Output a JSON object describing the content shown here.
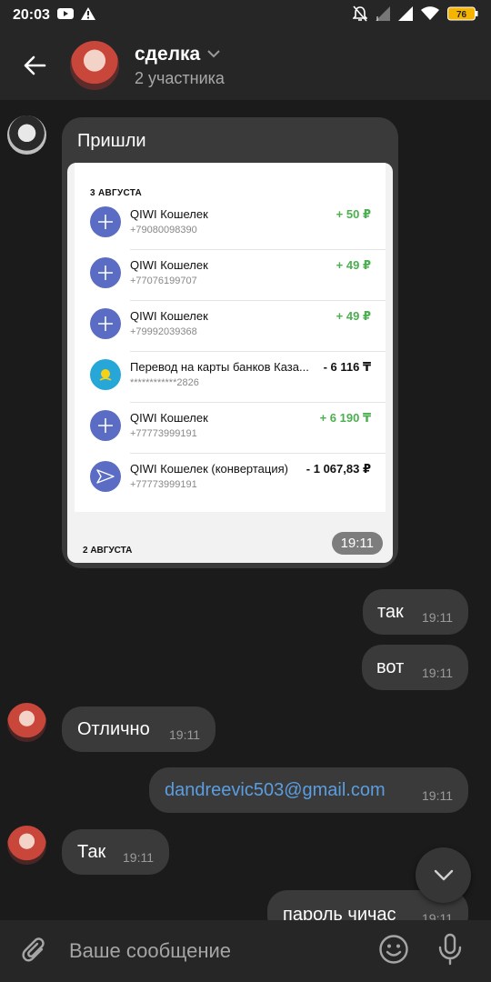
{
  "status_bar": {
    "time": "20:03",
    "battery": "76"
  },
  "header": {
    "title": "сделка",
    "subtitle": "2 участника"
  },
  "card": {
    "caption": "Пришли",
    "date_top": "3 АВГУСТА",
    "transactions": [
      {
        "name": "QIWI Кошелек",
        "sub": "+79080098390",
        "amount": "+ 50 ₽",
        "kind": "pos",
        "icon": "plus-icon"
      },
      {
        "name": "QIWI Кошелек",
        "sub": "+77076199707",
        "amount": "+ 49 ₽",
        "kind": "pos",
        "icon": "plus-icon"
      },
      {
        "name": "QIWI Кошелек",
        "sub": "+79992039368",
        "amount": "+ 49 ₽",
        "kind": "pos",
        "icon": "plus-icon"
      },
      {
        "name": "Перевод на карты банков Каза...",
        "sub": "************2826",
        "amount": "- 6 116 ₸",
        "kind": "neg",
        "icon": "kazakhstan-flag-icon"
      },
      {
        "name": "QIWI Кошелек",
        "sub": "+77773999191",
        "amount": "+ 6 190 ₸",
        "kind": "pos",
        "icon": "plus-icon"
      },
      {
        "name": "QIWI Кошелек (конвертация)",
        "sub": "+77773999191",
        "amount": "- 1 067,83 ₽",
        "kind": "neg",
        "icon": "convert-icon"
      }
    ],
    "date_bottom": "2 АВГУСТА",
    "time": "19:11"
  },
  "messages": [
    {
      "text": "так",
      "time": "19:11"
    },
    {
      "text": "вот",
      "time": "19:11"
    },
    {
      "text": "Отлично",
      "time": "19:11"
    },
    {
      "text": "dandreevic503@gmail.com",
      "time": "19:11"
    },
    {
      "text": "Так",
      "time": "19:11"
    },
    {
      "text": "пароль чичас",
      "time": "19:11"
    }
  ],
  "composer": {
    "placeholder": "Ваше сообщение"
  },
  "colors": {
    "accent": "#5b6cc4",
    "link": "#5b9ee0",
    "positive": "#4caf50",
    "bubble": "#3a3a3a",
    "background": "#1b1b1b"
  }
}
